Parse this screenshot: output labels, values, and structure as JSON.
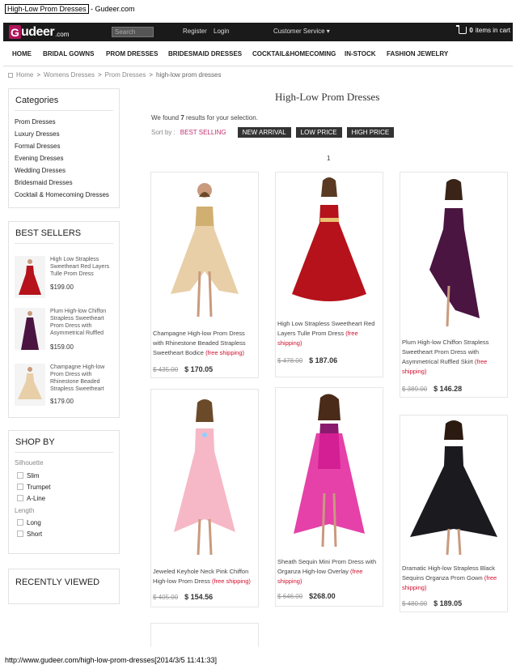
{
  "print": {
    "title_link": "High-Low Prom Dresses",
    "title_rest": " - Gudeer.com",
    "footer_url": "http://www.gudeer.com/high-low-prom-dresses[2014/3/5 11:41:33]"
  },
  "topbar": {
    "logo_g": "G",
    "logo_rest": "udeer",
    "logo_com": ".com",
    "search_placeholder": "Search",
    "register": "Register",
    "login": "Login",
    "customer_service": "Customer Service ▾",
    "cart_count": "0",
    "cart_label": "items in cart"
  },
  "nav": {
    "items": [
      "HOME",
      "BRIDAL GOWNS",
      "PROM DRESSES",
      "BRIDESMAID DRESSES",
      "COCKTAIL&HOMECOMING",
      "IN-STOCK",
      "FASHION JEWELRY"
    ]
  },
  "breadcrumb": {
    "home": "Home",
    "sep": ">",
    "womens": "Womens Dresses",
    "prom": "Prom Dresses",
    "current": "high-low prom dresses"
  },
  "sidebar": {
    "categories_title": "Categories",
    "categories": [
      "Prom Dresses",
      "Luxury Dresses",
      "Formal Dresses",
      "Evening Dresses",
      "Wedding Dresses",
      "Bridesmaid Dresses",
      "Cocktail & Homecoming Dresses"
    ],
    "bestsellers_title": "BEST SELLERS",
    "bestsellers": [
      {
        "name": "High Low Strapless Sweetheart Red Layers Tulle Prom Dress",
        "price": "$199.00"
      },
      {
        "name": "Plum High-low Chiffon Strapless Sweetheart Prom Dress with Asymmetrical Ruffled",
        "price": "$159.00"
      },
      {
        "name": "Champagne High-low Prom Dress with Rhinestone Beaded Strapless Sweetheart",
        "price": "$179.00"
      }
    ],
    "shopby_title": "SHOP BY",
    "silhouette_label": "Silhouette",
    "silhouettes": [
      "Slim",
      "Trumpet",
      "A-Line"
    ],
    "length_label": "Length",
    "lengths": [
      "Long",
      "Short"
    ],
    "recent_title": "RECENTLY VIEWED"
  },
  "main": {
    "title": "High-Low Prom Dresses",
    "results_pre": "We found ",
    "results_count": "7",
    "results_post": " results for your selection.",
    "sort_label": "Sort by :",
    "sort_options": [
      "BEST SELLING",
      "NEW ARRIVAL",
      "LOW PRICE",
      "HIGH PRICE"
    ],
    "page": "1",
    "products": [
      {
        "name": "Champagne High-low Prom Dress with Rhinestone Beaded Strapless Sweetheart Bodice",
        "ship": "(free shipping)",
        "old_price": "$ 435.00",
        "price": "$ 170.05",
        "color": "#e8cfa8"
      },
      {
        "name": "High Low Strapless Sweetheart Red Layers Tulle Prom Dress",
        "ship": "(free shipping)",
        "old_price": "$ 478.00",
        "price": "$ 187.06",
        "color": "#b5121b"
      },
      {
        "name": "Plum High-low Chiffon Strapless Sweetheart Prom Dress with Asymmetrical Ruffled Skirt",
        "ship": "(free shipping)",
        "old_price": "$ 389.00",
        "price": "$ 146.28",
        "color": "#4a1540"
      },
      {
        "name": "Jeweled Keyhole Neck Pink Chiffon High-low Prom Dress",
        "ship": "(free shipping)",
        "old_price": "$ 405.00",
        "price": "$ 154.56",
        "color": "#f6b8c6"
      },
      {
        "name": "Sheath Sequin Mini Prom Dress with Organza High-low Overlay",
        "ship": "(free shipping)",
        "old_price": "$ 646.00",
        "price": "$268.00",
        "color": "#e0209a"
      },
      {
        "name": "Dramatic High-low Strapless Black Sequins Organza Prom Gown",
        "ship": "(free shipping)",
        "old_price": "$ 480.00",
        "price": "$ 189.05",
        "color": "#1a1a1f"
      }
    ]
  }
}
